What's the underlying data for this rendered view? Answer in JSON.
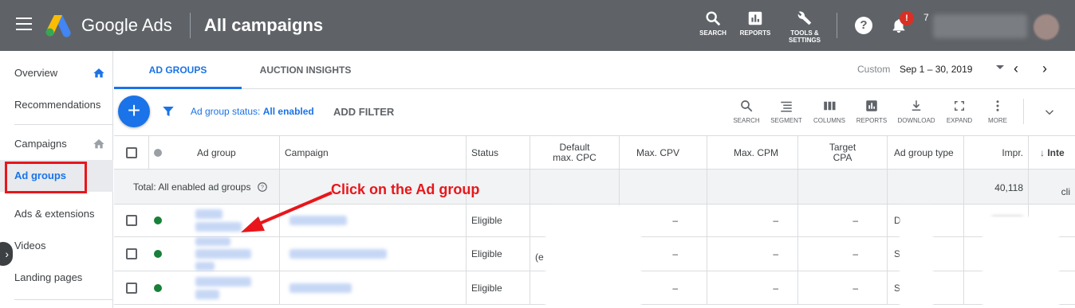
{
  "topbar": {
    "brand": "Google Ads",
    "title": "All campaigns",
    "tools": [
      {
        "label": "SEARCH",
        "icon": "search-icon"
      },
      {
        "label": "REPORTS",
        "icon": "reports-icon"
      },
      {
        "label1": "TOOLS &",
        "label2": "SETTINGS",
        "icon": "wrench-icon"
      }
    ],
    "notification_badge": "!",
    "help": "?",
    "account_num": "7"
  },
  "sidebar": {
    "items": [
      {
        "label": "Overview"
      },
      {
        "label": "Recommendations"
      },
      {
        "label": "Campaigns"
      },
      {
        "label": "Ad groups"
      },
      {
        "label": "Ads & extensions"
      },
      {
        "label": "Videos"
      },
      {
        "label": "Landing pages"
      }
    ]
  },
  "tabs": [
    {
      "label": "AD GROUPS"
    },
    {
      "label": "AUCTION INSIGHTS"
    }
  ],
  "date": {
    "custom_label": "Custom",
    "range": "Sep 1 – 30, 2019"
  },
  "filter": {
    "status_prefix": "Ad group status: ",
    "status_value": "All enabled",
    "add_filter": "ADD FILTER"
  },
  "table_tools": [
    "SEARCH",
    "SEGMENT",
    "COLUMNS",
    "REPORTS",
    "DOWNLOAD",
    "EXPAND",
    "MORE"
  ],
  "table": {
    "headers": {
      "ad_group": "Ad group",
      "campaign": "Campaign",
      "status": "Status",
      "default_max_cpc_1": "Default",
      "default_max_cpc_2": "max. CPC",
      "max_cpv": "Max. CPV",
      "max_cpm": "Max. CPM",
      "target_cpa_1": "Target",
      "target_cpa_2": "CPA",
      "ad_group_type": "Ad group type",
      "impr": "Impr.",
      "inte": "Inte"
    },
    "total": {
      "label": "Total: All enabled ad groups",
      "impr": "40,118",
      "extra": "cli"
    },
    "rows": [
      {
        "status": "Eligible",
        "max_cpv": "–",
        "max_cpm": "–",
        "target_cpa": "–",
        "type_prefix": "D",
        "cpc_prefix": ""
      },
      {
        "status": "Eligible",
        "max_cpv": "–",
        "max_cpm": "–",
        "target_cpa": "–",
        "type_prefix": "S",
        "cpc_prefix": "(e"
      },
      {
        "status": "Eligible",
        "max_cpv": "–",
        "max_cpm": "–",
        "target_cpa": "–",
        "type_prefix": "S",
        "cpc_prefix": ""
      }
    ]
  },
  "annotation": {
    "text": "Click on the Ad group"
  },
  "colors": {
    "accent": "#1a73e8",
    "topbar": "#5f6368",
    "annotation": "#e8161b",
    "eligible_dot": "#188038"
  }
}
